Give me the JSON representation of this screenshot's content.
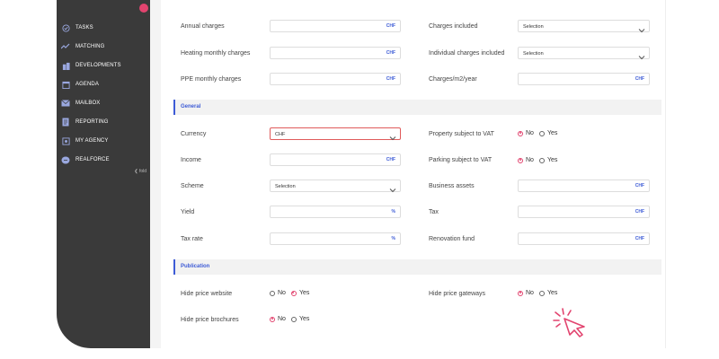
{
  "sidebar": {
    "items": [
      {
        "label": "TASKS",
        "icon": "check-circle-icon"
      },
      {
        "label": "MATCHING",
        "icon": "matching-icon"
      },
      {
        "label": "DEVELOPMENTS",
        "icon": "building-icon"
      },
      {
        "label": "AGENDA",
        "icon": "calendar-icon"
      },
      {
        "label": "MAILBOX",
        "icon": "mail-icon"
      },
      {
        "label": "REPORTING",
        "icon": "report-icon"
      },
      {
        "label": "MY AGENCY",
        "icon": "agency-icon"
      },
      {
        "label": "REALFORCE",
        "icon": "realforce-icon"
      }
    ],
    "collapse_label": "❮ fold"
  },
  "form": {
    "annual_charges": {
      "label": "Annual charges",
      "unit": "CHF"
    },
    "charges_included": {
      "label": "Charges included",
      "value": "Selection"
    },
    "heating_monthly": {
      "label": "Heating monthly charges",
      "unit": "CHF"
    },
    "individual_charges": {
      "label": "Individual charges included",
      "value": "Selection"
    },
    "ppe_monthly": {
      "label": "PPE monthly charges",
      "unit": "CHF"
    },
    "charges_m2": {
      "label": "Charges/m2/year",
      "unit": "CHF"
    }
  },
  "general": {
    "title": "General",
    "currency": {
      "label": "Currency",
      "value": "CHF"
    },
    "property_vat": {
      "label": "Property subject to VAT",
      "options": [
        "No",
        "Yes"
      ],
      "selected": "No"
    },
    "income": {
      "label": "Income",
      "unit": "CHF"
    },
    "parking_vat": {
      "label": "Parking subject to VAT",
      "options": [
        "No",
        "Yes"
      ],
      "selected": "No"
    },
    "scheme": {
      "label": "Scheme",
      "value": "Selection"
    },
    "business_assets": {
      "label": "Business assets",
      "unit": "CHF"
    },
    "yield": {
      "label": "Yield",
      "unit": "%"
    },
    "tax": {
      "label": "Tax",
      "unit": "CHF"
    },
    "tax_rate": {
      "label": "Tax rate",
      "unit": "%"
    },
    "renovation_fund": {
      "label": "Renovation fund",
      "unit": "CHF"
    }
  },
  "publication": {
    "title": "Publication",
    "hide_price_website": {
      "label": "Hide price website",
      "options": [
        "No",
        "Yes"
      ],
      "selected": "Yes"
    },
    "hide_price_gateways": {
      "label": "Hide price gateways",
      "options": [
        "No",
        "Yes"
      ],
      "selected": "No"
    },
    "hide_price_brochures": {
      "label": "Hide price brochures",
      "options": [
        "No",
        "Yes"
      ],
      "selected": "No"
    }
  },
  "colors": {
    "accent": "#3d5bd6",
    "brand": "#e2446f",
    "sidebar": "#3a3a3a"
  }
}
